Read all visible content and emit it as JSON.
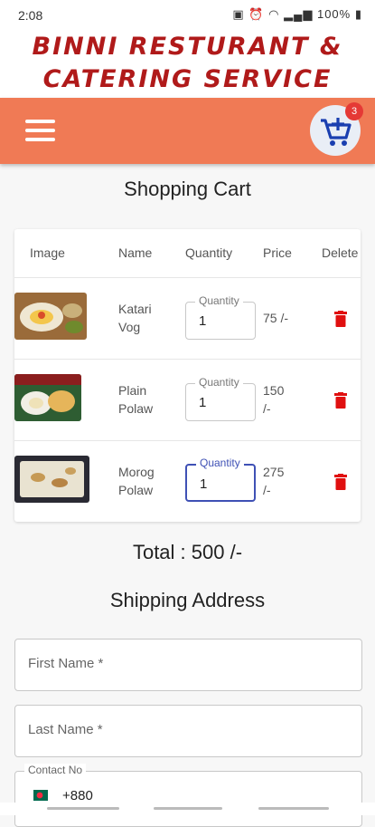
{
  "status_bar": {
    "time": "2:08",
    "battery": "100%"
  },
  "brand": {
    "line1": "BINNI RESTURANT &",
    "line2": "CATERING SERVICE"
  },
  "app_bar": {
    "cart_count": "3"
  },
  "page_title": "Shopping Cart",
  "table": {
    "headers": {
      "image": "Image",
      "name": "Name",
      "quantity": "Quantity",
      "price": "Price",
      "delete": "Delete"
    },
    "items": [
      {
        "name_line1": "Katari",
        "name_line2": "Vog",
        "quantity_label": "Quantity",
        "quantity": "1",
        "price_line1": "75 /-",
        "price_line2": ""
      },
      {
        "name_line1": "Plain",
        "name_line2": "Polaw",
        "quantity_label": "Quantity",
        "quantity": "1",
        "price_line1": "150",
        "price_line2": "/-"
      },
      {
        "name_line1": "Morog",
        "name_line2": "Polaw",
        "quantity_label": "Quantity",
        "quantity": "1",
        "price_line1": "275",
        "price_line2": "/-"
      }
    ]
  },
  "total": "Total : 500 /-",
  "shipping": {
    "title": "Shipping Address",
    "first_name_placeholder": "First Name *",
    "last_name_placeholder": "Last Name *",
    "contact_label": "Contact No",
    "contact_prefix": "+880"
  },
  "colors": {
    "app_bar": "#f07a55",
    "brand_text": "#b01a1a",
    "delete_icon": "#e01010",
    "focus": "#3f51b5"
  }
}
